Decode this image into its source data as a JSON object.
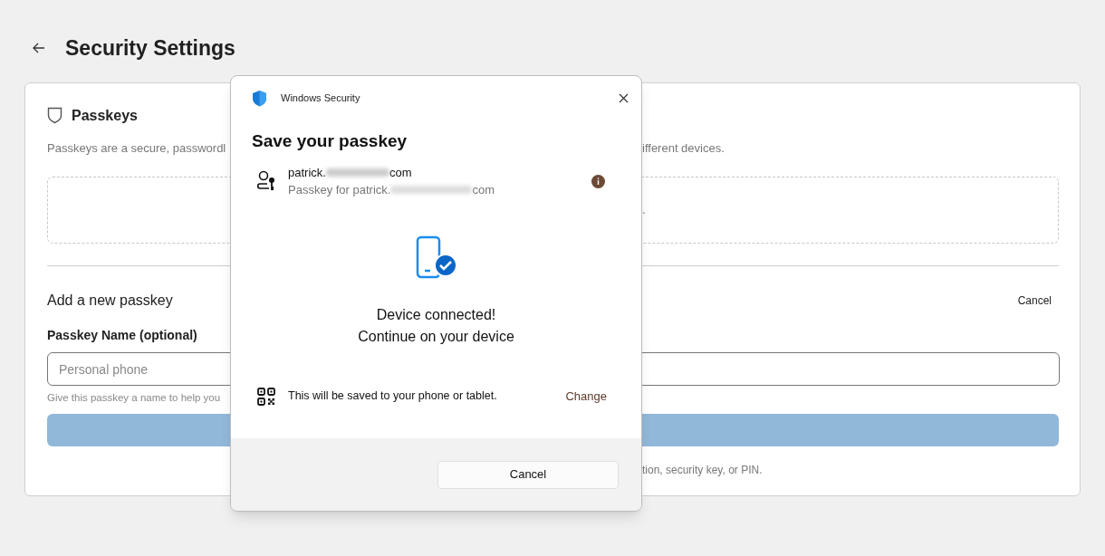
{
  "page": {
    "title": "Security Settings"
  },
  "passkeys": {
    "heading": "Passkeys",
    "description_start": "Passkeys are a secure, passwordl",
    "description_end": "ifferent devices.",
    "empty_end": "."
  },
  "add": {
    "heading": "Add a new passkey",
    "cancel": "Cancel",
    "label": "Passkey Name (optional)",
    "placeholder": "Personal phone",
    "hint_start": "Give this passkey a name to help you",
    "footnote_end": "tion, security key, or PIN."
  },
  "dialog": {
    "app": "Windows Security",
    "title": "Save your passkey",
    "account": {
      "name_start": "patrick.",
      "name_end": "com",
      "detail_start": "Passkey for patrick.",
      "detail_end": "com"
    },
    "status": [
      "Device connected!",
      "Continue on your device"
    ],
    "destination": {
      "text": "This will be saved to your phone or tablet.",
      "action": "Change"
    },
    "buttons": [
      "Cancel"
    ]
  }
}
